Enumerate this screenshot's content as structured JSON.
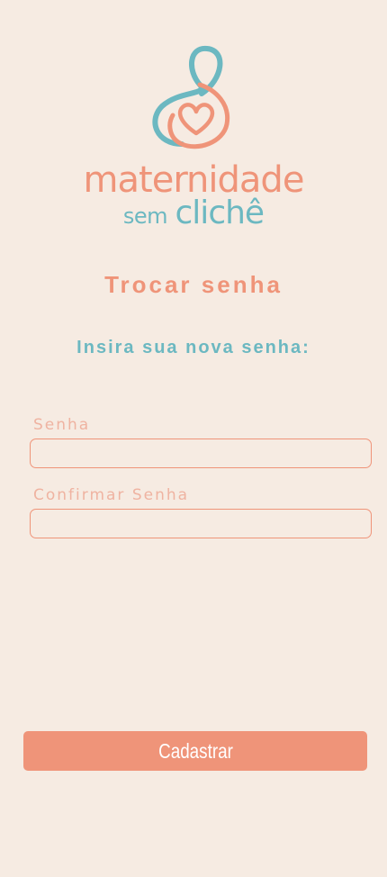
{
  "logo": {
    "line1": "maternidade",
    "line2_small": "sem",
    "line2_large": "clichê"
  },
  "page": {
    "title": "Trocar senha",
    "subtitle": "Insira sua nova senha:"
  },
  "form": {
    "password_label": "Senha",
    "password_value": "",
    "confirm_label": "Confirmar Senha",
    "confirm_value": "",
    "submit_label": "Cadastrar"
  },
  "colors": {
    "background": "#f6ebe2",
    "accent_coral": "#ef9479",
    "accent_teal": "#6cb8c1"
  }
}
